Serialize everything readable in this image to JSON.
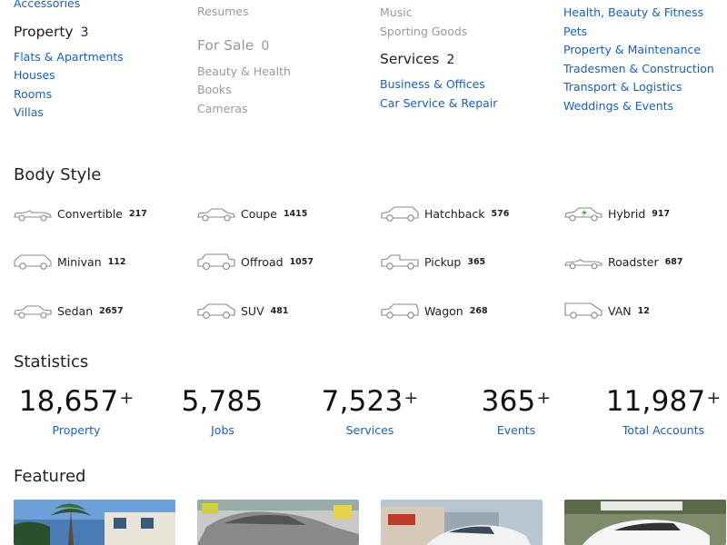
{
  "categories": {
    "col1": {
      "top_item": "Accessories",
      "heading": "Property",
      "count": "3",
      "items": [
        "Flats & Apartments",
        "Houses",
        "Rooms",
        "Villas"
      ]
    },
    "col2": {
      "top_item": "Resumes",
      "heading": "For Sale",
      "count": "0",
      "items": [
        "Beauty & Health",
        "Books",
        "Cameras"
      ]
    },
    "col3": {
      "items_top": [
        "Music",
        "Sporting Goods"
      ],
      "heading": "Services",
      "count": "2",
      "items": [
        "Business & Offices",
        "Car Service & Repair"
      ]
    },
    "col4": {
      "items": [
        "Health, Beauty & Fitness",
        "Pets",
        "Property & Maintenance",
        "Tradesmen & Construction",
        "Transport & Logistics",
        "Weddings & Events"
      ]
    }
  },
  "body_style": {
    "title": "Body Style",
    "items": [
      {
        "name": "Convertible",
        "count": "217",
        "icon": "convertible-icon"
      },
      {
        "name": "Coupe",
        "count": "1415",
        "icon": "coupe-icon"
      },
      {
        "name": "Hatchback",
        "count": "576",
        "icon": "hatchback-icon"
      },
      {
        "name": "Hybrid",
        "count": "917",
        "icon": "hybrid-icon"
      },
      {
        "name": "Minivan",
        "count": "112",
        "icon": "minivan-icon"
      },
      {
        "name": "Offroad",
        "count": "1057",
        "icon": "offroad-icon"
      },
      {
        "name": "Pickup",
        "count": "365",
        "icon": "pickup-icon"
      },
      {
        "name": "Roadster",
        "count": "687",
        "icon": "roadster-icon"
      },
      {
        "name": "Sedan",
        "count": "2657",
        "icon": "sedan-icon"
      },
      {
        "name": "SUV",
        "count": "481",
        "icon": "suv-icon"
      },
      {
        "name": "Wagon",
        "count": "268",
        "icon": "wagon-icon"
      },
      {
        "name": "VAN",
        "count": "12",
        "icon": "van-icon"
      }
    ]
  },
  "statistics": {
    "title": "Statistics",
    "items": [
      {
        "value": "18,657",
        "plus": "+",
        "label": "Property"
      },
      {
        "value": "5,785",
        "plus": "",
        "label": "Jobs"
      },
      {
        "value": "7,523",
        "plus": "+",
        "label": "Services"
      },
      {
        "value": "365",
        "plus": "+",
        "label": "Events"
      },
      {
        "value": "11,987",
        "plus": "+",
        "label": "Total Accounts"
      }
    ]
  },
  "featured": {
    "title": "Featured"
  },
  "colors": {
    "link": "#1a5fb4",
    "muted": "#9a9a9a",
    "text": "#222222"
  }
}
